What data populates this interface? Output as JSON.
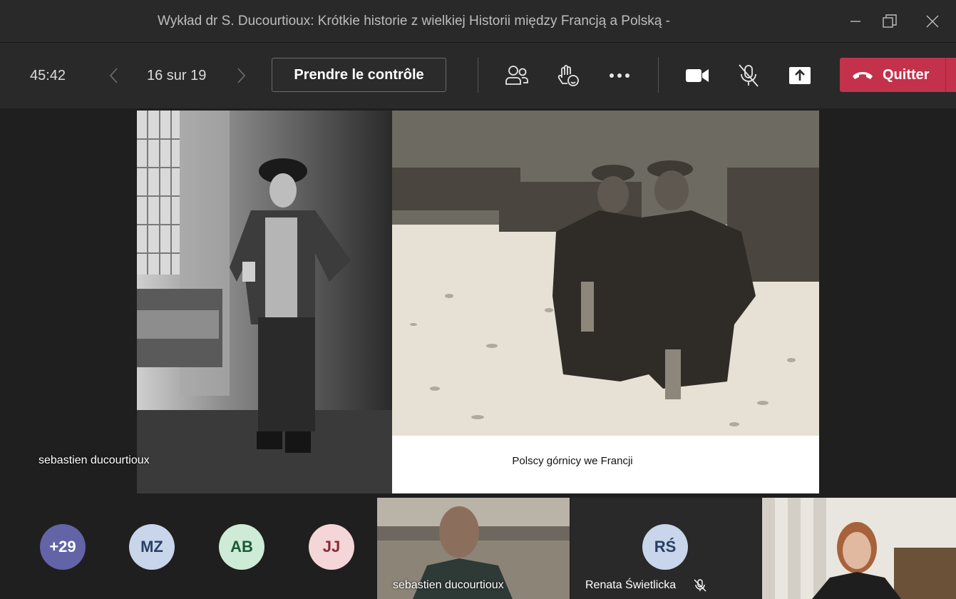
{
  "window": {
    "title": "Wykład dr S. Ducourtioux: Krótkie historie z wielkiej Historii między Francją a Polską -"
  },
  "toolbar": {
    "timer": "45:42",
    "page_counter": "16 sur 19",
    "take_control_label": "Prendre le contrôle",
    "leave_label": "Quitter",
    "leave_color": "#c4314b"
  },
  "stage": {
    "presenter_name": "sebastien ducourtioux",
    "slide_caption": "Polscy górnicy we Francji"
  },
  "participants": {
    "overflow_count": "+29",
    "avatars": [
      {
        "initials": "MZ",
        "bg": "#c8d5ea",
        "fg": "#2a3f66"
      },
      {
        "initials": "AB",
        "bg": "#cdebd6",
        "fg": "#1d5a36"
      },
      {
        "initials": "JJ",
        "bg": "#f4d5d8",
        "fg": "#8a2a36"
      }
    ],
    "overflow_bg": "#6264a7",
    "video_tile_name": "sebastien ducourtioux",
    "renata": {
      "initials": "RŚ",
      "name": "Renata Świetlicka",
      "bg": "#c8d5ea",
      "fg": "#2a3f66"
    }
  }
}
